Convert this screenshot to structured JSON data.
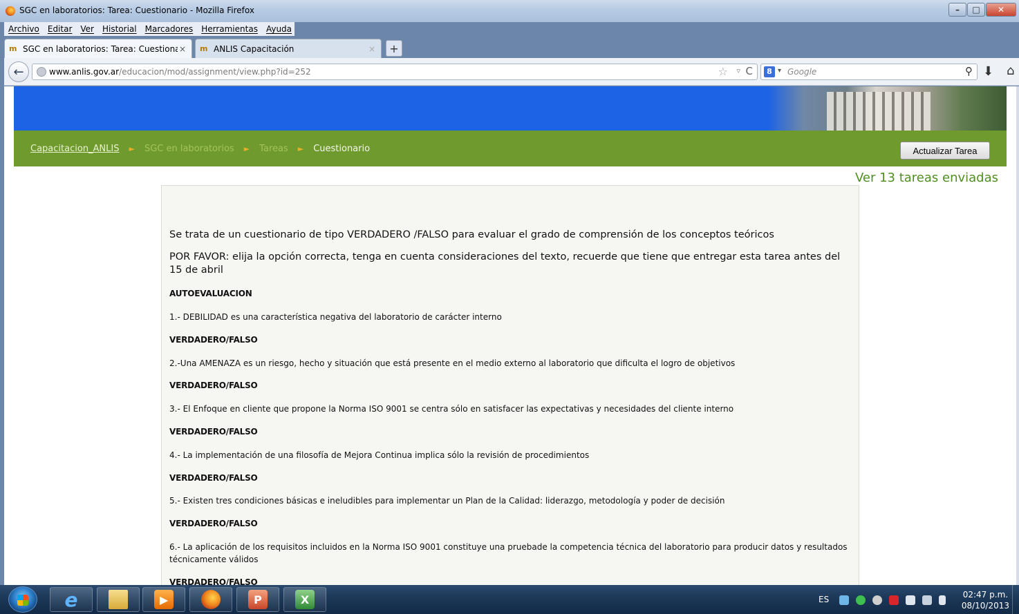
{
  "window": {
    "title": "SGC en laboratorios: Tarea: Cuestionario - Mozilla Firefox"
  },
  "menu": [
    "Archivo",
    "Editar",
    "Ver",
    "Historial",
    "Marcadores",
    "Herramientas",
    "Ayuda"
  ],
  "tabs": [
    {
      "label": "SGC en laboratorios: Tarea: Cuestiona...",
      "close": "×",
      "active": true
    },
    {
      "label": "ANLIS Capacitación",
      "close": "×",
      "active": false
    }
  ],
  "newtab": "+",
  "navbar": {
    "back": "←",
    "url_domain": "www.anlis.gov.ar",
    "url_path": "/educacion/mod/assignment/view.php?id=252",
    "star": "☆",
    "dropdown": "▿",
    "reload": "C",
    "search_engine": "8",
    "search_placeholder": "Google",
    "search_icon": "⚲",
    "download": "⬇",
    "home": "⌂"
  },
  "page": {
    "breadcrumb": [
      "Capacitacion_ANLIS",
      "SGC en laboratorios",
      "Tareas",
      "Cuestionario"
    ],
    "breadcrumb_sep": "►",
    "update_button": "Actualizar Tarea",
    "submissions_link": "Ver 13 tareas enviadas",
    "intro": {
      "p1": "Se trata de un cuestionario de tipo VERDADERO /FALSO para evaluar el grado de comprensión de los conceptos teóricos",
      "p2": "POR FAVOR: elija la opción correcta, tenga en cuenta consideraciones del texto, recuerde que tiene que entregar esta tarea antes del 15 de abril",
      "heading": "AUTOEVALUACION",
      "answer_label": "VERDADERO/FALSO",
      "questions": [
        "1.- DEBILIDAD es una característica negativa del laboratorio de carácter interno",
        "2.-Una AMENAZA es un riesgo, hecho y situación que está presente en el medio externo al laboratorio que dificulta el logro de objetivos",
        "3.- El Enfoque en cliente que propone la Norma ISO 9001 se centra sólo en satisfacer las expectativas y necesidades del cliente interno",
        "4.- La implementación de una filosofía de Mejora Continua implica sólo la revisión de procedimientos",
        "5.- Existen tres condiciones básicas e ineludibles para implementar un Plan de la Calidad: liderazgo, metodología y poder de decisión",
        "6.- La aplicación de los requisitos incluidos en la Norma ISO 9001 constituye una pruebade la competencia técnica del laboratorio para producir datos y resultados técnicamente válidos"
      ]
    }
  },
  "taskbar": {
    "language": "ES",
    "time": "02:47 p.m.",
    "date": "08/10/2013"
  },
  "colors": {
    "banner_blue": "#1d63e6",
    "breadcrumb_green": "#6f9a2e",
    "link_green": "#4f8f20"
  }
}
